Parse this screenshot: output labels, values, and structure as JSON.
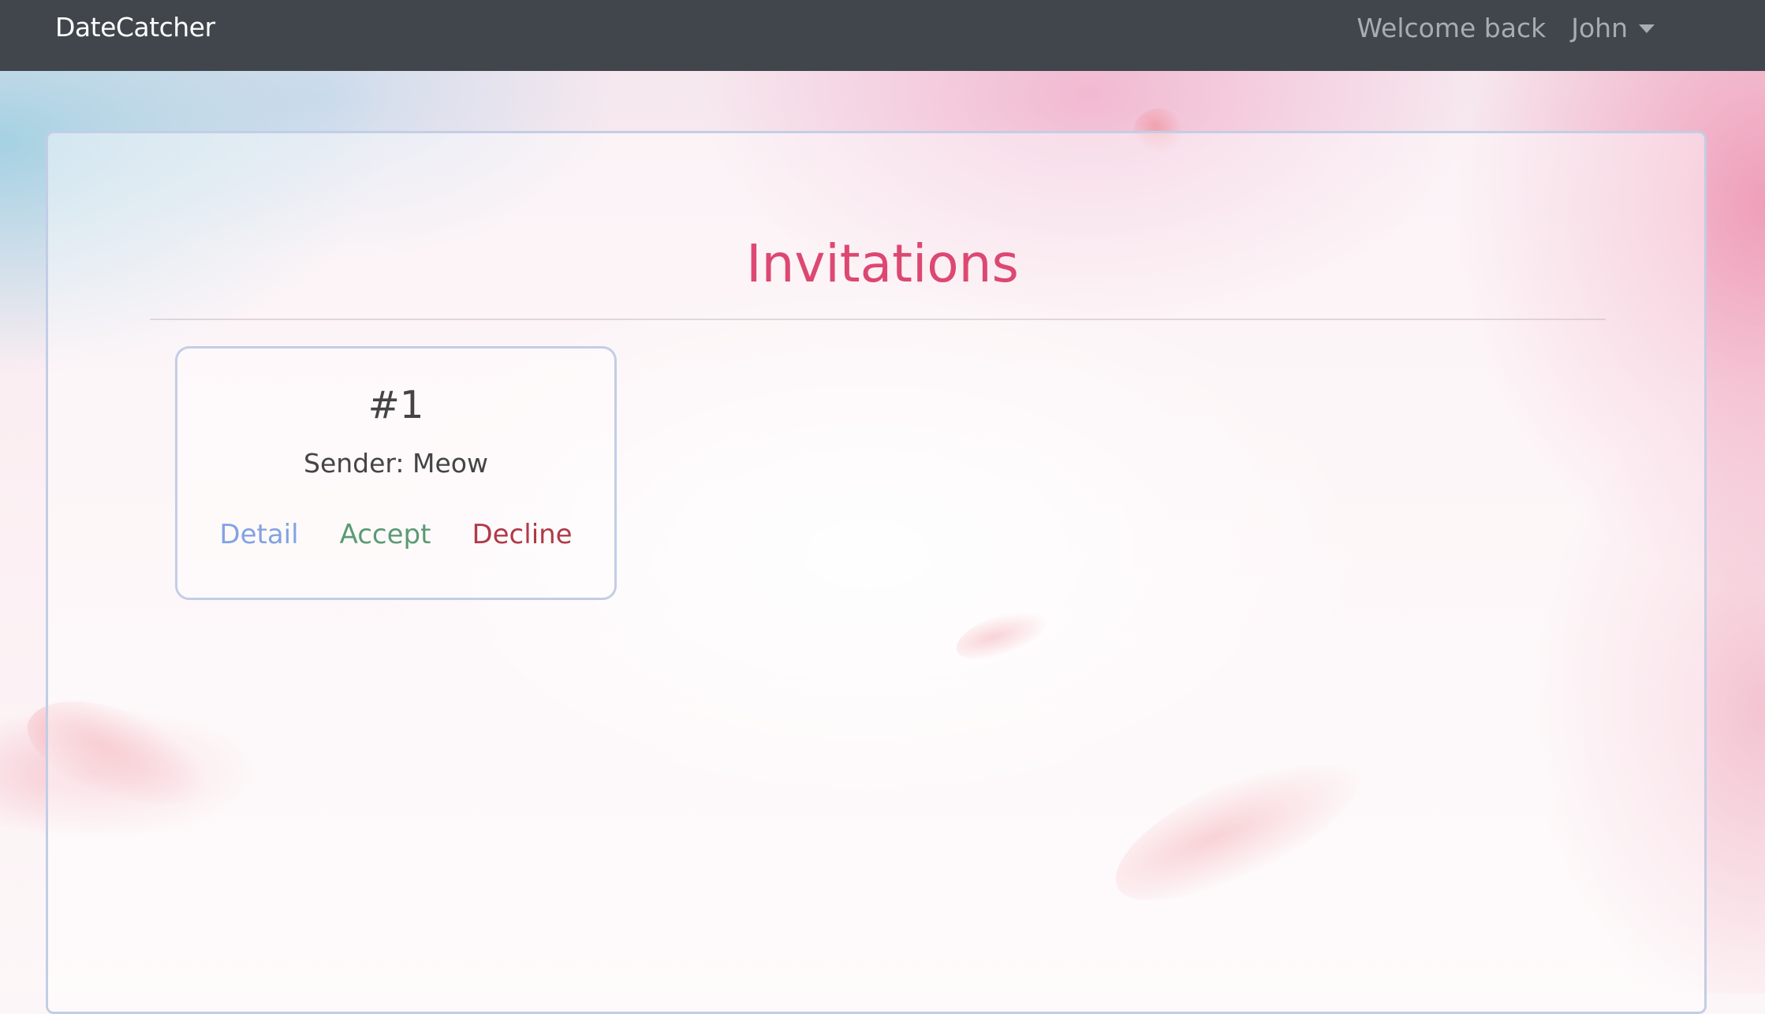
{
  "navbar": {
    "brand": "DateCatcher",
    "welcome_text": "Welcome back",
    "user_name": "John"
  },
  "main": {
    "title": "Invitations",
    "invitations": [
      {
        "number": "#1",
        "sender": "Sender: Meow",
        "actions": {
          "detail": "Detail",
          "accept": "Accept",
          "decline": "Decline"
        }
      }
    ]
  },
  "colors": {
    "navbar_bg": "#40464c",
    "title": "#dc4872",
    "detail_link": "#84a2e2",
    "accept_link": "#5b9a74",
    "decline_link": "#b03a48",
    "card_border": "#c3cde6"
  }
}
